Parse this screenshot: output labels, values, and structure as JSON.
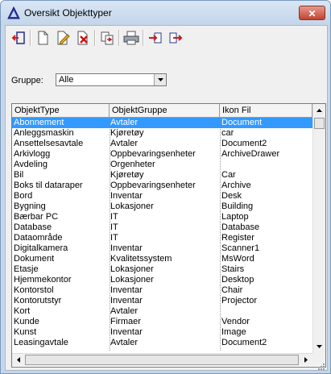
{
  "window": {
    "title": "Oversikt Objekttyper",
    "close_label": "✕"
  },
  "toolbar": {
    "buttons": [
      {
        "name": "exit-icon"
      },
      {
        "name": "new-document-icon"
      },
      {
        "name": "edit-icon"
      },
      {
        "name": "delete-icon"
      },
      {
        "name": "copy-document-icon"
      },
      {
        "name": "print-icon"
      },
      {
        "name": "import-icon"
      },
      {
        "name": "export-icon"
      }
    ]
  },
  "filter": {
    "label": "Gruppe:",
    "value": "Alle"
  },
  "list": {
    "columns": [
      "ObjektType",
      "ObjektGruppe",
      "Ikon Fil"
    ],
    "rows": [
      [
        "Abonnement",
        "Avtaler",
        "Document"
      ],
      [
        "Anleggsmaskin",
        "Kjøretøy",
        "car"
      ],
      [
        "Ansettelsesavtale",
        "Avtaler",
        "Document2"
      ],
      [
        "Arkivlogg",
        "Oppbevaringsenheter",
        "ArchiveDrawer"
      ],
      [
        "Avdeling",
        "Orgenheter",
        ""
      ],
      [
        "Bil",
        "Kjøretøy",
        "Car"
      ],
      [
        "Boks til dataraper",
        "Oppbevaringsenheter",
        "Archive"
      ],
      [
        "Bord",
        "Inventar",
        "Desk"
      ],
      [
        "Bygning",
        "Lokasjoner",
        "Building"
      ],
      [
        "Bærbar PC",
        "IT",
        "Laptop"
      ],
      [
        "Database",
        "IT",
        "Database"
      ],
      [
        "Dataområde",
        "IT",
        "Register"
      ],
      [
        "Digitalkamera",
        "Inventar",
        "Scanner1"
      ],
      [
        "Dokument",
        "Kvalitetssystem",
        "MsWord"
      ],
      [
        "Etasje",
        "Lokasjoner",
        "Stairs"
      ],
      [
        "Hjemmekontor",
        "Lokasjoner",
        "Desktop"
      ],
      [
        "Kontorstol",
        "Inventar",
        "Chair"
      ],
      [
        "Kontorutstyr",
        "Inventar",
        "Projector"
      ],
      [
        "Kort",
        "Avtaler",
        ""
      ],
      [
        "Kunde",
        "Firmaer",
        "Vendor"
      ],
      [
        "Kunst",
        "Inventar",
        "Image"
      ],
      [
        "Leasingavtale",
        "Avtaler",
        "Document2"
      ]
    ],
    "selected_index": 0
  }
}
